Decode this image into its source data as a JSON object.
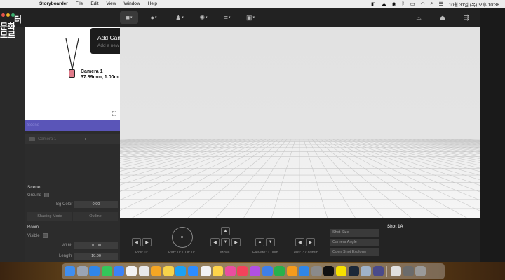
{
  "menubar": {
    "apple": "",
    "items": [
      "Storyboarder",
      "File",
      "Edit",
      "View",
      "Window",
      "Help"
    ],
    "clock": "10월 31일 (목) 오후 10:38"
  },
  "logo": {
    "line1": "터",
    "line2": "문화 모르"
  },
  "tooltip": {
    "title": "Add Camera",
    "subtitle": "Add a new camera in the scene"
  },
  "topview": {
    "camera_name": "Camera 1",
    "camera_info": "37.89mm, 1.00m"
  },
  "selection_bar": "Scene",
  "scene_list": {
    "row_label": "Camera 1",
    "row_arrow": "▸"
  },
  "scene_props": {
    "heading": "Scene",
    "ground_label": "Ground",
    "bg_color_label": "Bg Color",
    "bg_color_value": "0.90",
    "shading_label": "Shading Mode",
    "shading_value": "Outline",
    "room_heading": "Room",
    "visible_label": "Visible",
    "width_label": "Width",
    "width_value": "10.00",
    "length_label": "Length",
    "length_value": "10.00"
  },
  "controls": {
    "roll_label": "Roll: 0°",
    "pan_label": "Pan: 0° / Tilt: 0°",
    "move_label": "Move",
    "elevate_label": "Elevate: 1.00m",
    "lens_label": "Lens: 37.89mm",
    "shot_size": "Shot Size",
    "camera_angle": "Camera Angle",
    "open_shot_explorer": "Open Shot Explorer",
    "shot_title": "Shot 1A"
  },
  "colors": {
    "selection": "#5a55b8",
    "camera": "#e07b8a"
  },
  "icons": {
    "toolbar": [
      "add-camera-icon",
      "add-object-icon",
      "add-character-icon",
      "add-light-icon",
      "add-volume-icon",
      "add-image-icon",
      "vr-icon",
      "camera-tripod-icon",
      "hide-panel-icon"
    ]
  },
  "dock_apps": [
    "finder",
    "launchpad",
    "safari",
    "messages",
    "mail",
    "calendar",
    "chrome",
    "photos",
    "notes",
    "twitter",
    "zoom",
    "reminders",
    "stickies",
    "photos-app",
    "music",
    "podcasts",
    "keynote",
    "numbers",
    "pages",
    "app-store",
    "settings",
    "epic-games",
    "kakao",
    "steam",
    "preview",
    "storyboarder",
    "documents",
    "downloads",
    "trash"
  ]
}
